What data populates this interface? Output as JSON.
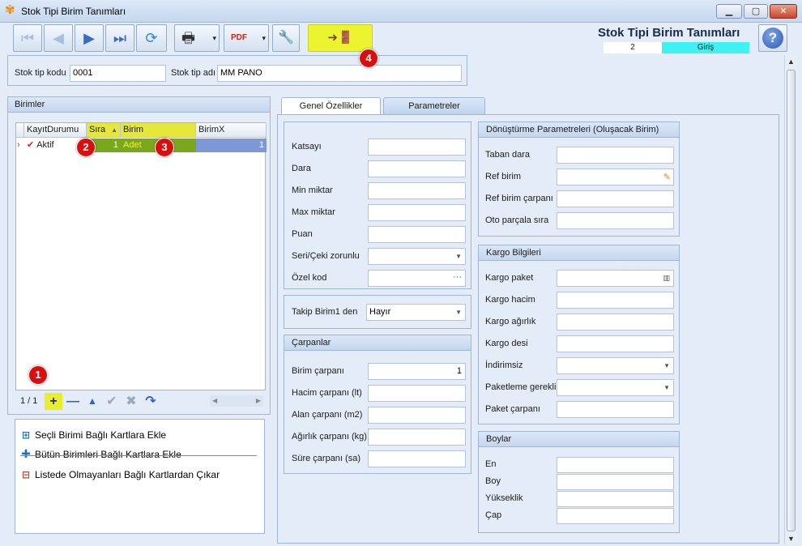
{
  "window": {
    "title": "Stok Tipi Birim Tanımları",
    "minimize": "▁",
    "maximize": "▢",
    "close": "✕"
  },
  "toolbar": {
    "first": "⏮",
    "prev": "◀",
    "next": "▶",
    "last": "⏭",
    "refresh": "⟳",
    "print": "🖶",
    "pdf": "PDF",
    "tools": "🔧",
    "exit": "➜🚪",
    "dropdown": "▾"
  },
  "header": {
    "form_title": "Stok Tipi Birim Tanımları",
    "record_no": "2",
    "mode": "Giriş",
    "help": "?",
    "stok_tip_kodu_label": "Stok tip kodu",
    "stok_tip_kodu_value": "0001",
    "stok_tip_adi_label": "Stok tip adı",
    "stok_tip_adi_value": "MM PANO"
  },
  "birimler": {
    "title": "Birimler",
    "columns": [
      "KayıtDurumu",
      "Sıra",
      "Birim",
      "BirimX"
    ],
    "rows": [
      {
        "indicator": "›",
        "status_icon": "✔",
        "kayit_durumu": "Aktif",
        "sira": "1",
        "birim": "Adet",
        "birimx": "1"
      }
    ],
    "pager": {
      "position": "1 / 1",
      "add": "+",
      "remove": "—",
      "up": "▲",
      "confirm": "✔",
      "cancel": "✖",
      "undo": "↷",
      "scroll_left": "◀",
      "scroll_right": "▶"
    }
  },
  "actions": [
    {
      "icon": "⊞",
      "label": "Seçli Birimi Bağlı Kartlara Ekle"
    },
    {
      "icon": "✚",
      "label": "Bütün Birimleri Bağlı Kartlara Ekle"
    },
    {
      "icon": "⊟",
      "label": "Listede Olmayanları Bağlı Kartlardan Çıkar"
    }
  ],
  "tabs": {
    "genel": "Genel Özellikler",
    "parametreler": "Parametreler"
  },
  "genel": {
    "katsayi_label": "Katsayı",
    "katsayi_value": "",
    "dara_label": "Dara",
    "dara_value": "",
    "min_miktar_label": "Min miktar",
    "min_miktar_value": "",
    "max_miktar_label": "Max miktar",
    "max_miktar_value": "",
    "puan_label": "Puan",
    "puan_value": "",
    "seri_label": "Seri/Çeki zorunlu",
    "seri_value": "",
    "ozel_kod_label": "Özel kod",
    "ozel_kod_value": "",
    "takip_label": "Takip Birim1 den",
    "takip_value": "Hayır"
  },
  "carpanlar": {
    "title": "Çarpanlar",
    "birim_label": "Birim çarpanı",
    "birim_value": "1",
    "hacim_label": "Hacim çarpanı (lt)",
    "hacim_value": "",
    "alan_label": "Alan çarpanı (m2)",
    "alan_value": "",
    "agirlik_label": "Ağırlık çarpanı (kg)",
    "agirlik_value": "",
    "sure_label": "Süre çarpanı (sa)",
    "sure_value": ""
  },
  "donusturme": {
    "title": "Dönüştürme Parametreleri (Oluşacak Birim)",
    "taban_dara_label": "Taban dara",
    "taban_dara_value": "",
    "ref_birim_label": "Ref birim",
    "ref_birim_value": "",
    "ref_carpan_label": "Ref birim çarpanı",
    "ref_carpan_value": "",
    "oto_parcala_label": "Oto parçala sıra",
    "oto_parcala_value": ""
  },
  "kargo": {
    "title": "Kargo Bilgileri",
    "paket_label": "Kargo paket",
    "paket_value": "",
    "hacim_label": "Kargo hacim",
    "hacim_value": "",
    "agirlik_label": "Kargo ağırlık",
    "agirlik_value": "",
    "desi_label": "Kargo desi",
    "desi_value": "",
    "indirimsiz_label": "İndirimsiz",
    "indirimsiz_value": "",
    "paketleme_label": "Paketleme gerekli",
    "paketleme_value": "",
    "paket_carpan_label": "Paket çarpanı",
    "paket_carpan_value": ""
  },
  "boylar": {
    "title": "Boylar",
    "en_label": "En",
    "en_value": "",
    "boy_label": "Boy",
    "boy_value": "",
    "yukseklik_label": "Yükseklik",
    "yukseklik_value": "",
    "cap_label": "Çap",
    "cap_value": ""
  },
  "callouts": [
    "1",
    "2",
    "3",
    "4"
  ],
  "colors": {
    "highlight_yellow": "#ecf42f",
    "row_green": "#79a81c",
    "row_blue": "#7e97d6",
    "mode_cyan": "#3ef2f4",
    "callout_red": "#d90f0f"
  }
}
